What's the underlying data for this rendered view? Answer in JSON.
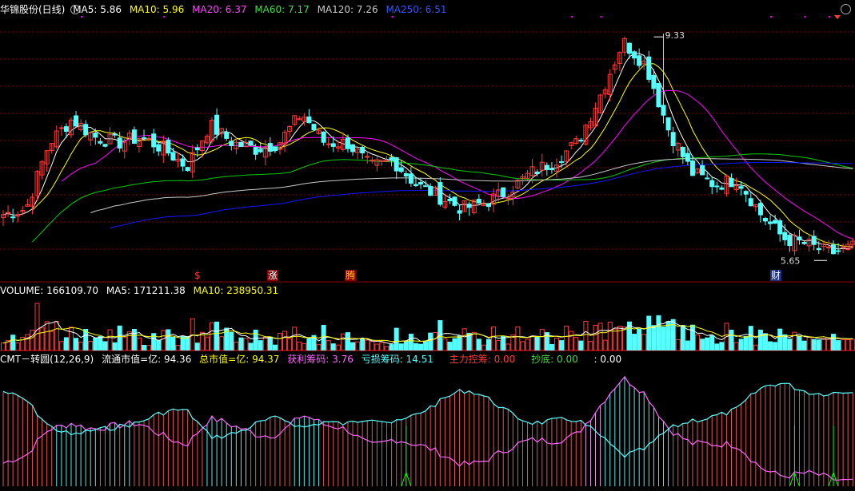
{
  "price_info": {
    "stock_name": "华锦股份(日线)",
    "ma5": "MA5: 5.86",
    "ma10": "MA10: 5.96",
    "ma20": "MA20: 6.37",
    "ma60": "MA60: 7.17",
    "ma120": "MA120: 7.26",
    "ma250": "MA250: 6.51"
  },
  "volume_info": {
    "volume": "VOLUME: 166109.70",
    "ma5": "MA5: 171211.38",
    "ma10": "MA10: 238950.31"
  },
  "cmt_info": {
    "name": "CMT－转圆(12,26,9)",
    "float_cap": "流通市值=亿: 94.36",
    "total_cap": "总市值=亿: 94.37",
    "profit_chips": "获利筹码: 3.76",
    "loss_chips": "亏损筹码: 14.51",
    "main_control": "主力控筹: 0.00",
    "bottom": "抄底: 0.00",
    "blank": ": 0.00"
  },
  "markers": {
    "m1": "$",
    "m2": "涨",
    "m3": "腾",
    "m4": "财"
  },
  "colors": {
    "background": "#000000",
    "up": "#ff3b3b",
    "down": "#54ffff",
    "ma5": "#ffffff",
    "ma10": "#ffff00",
    "ma20": "#ff00ff",
    "ma60": "#00cc00",
    "ma120": "#c8c8c8",
    "ma250": "#1414ff",
    "grid": "#8b0000"
  },
  "chart_data": [
    {
      "type": "candlestick",
      "title": "华锦股份(日线)",
      "high_label": "9.33",
      "low_label": "5.65",
      "y_range": [
        5.4,
        9.6
      ],
      "ma_last": {
        "MA5": 5.86,
        "MA10": 5.96,
        "MA20": 6.37,
        "MA60": 7.17,
        "MA120": 7.26,
        "MA250": 6.51
      },
      "close_waypoints": [
        6.3,
        6.4,
        7.5,
        7.9,
        7.6,
        7.5,
        7.6,
        7.4,
        7.1,
        7.8,
        7.5,
        7.4,
        7.5,
        8.0,
        7.5,
        7.5,
        7.1,
        7.2,
        6.8,
        6.6,
        6.4,
        6.5,
        6.7,
        7.0,
        7.2,
        7.5,
        8.3,
        9.2,
        8.8,
        7.7,
        7.0,
        6.8,
        6.9,
        6.3,
        5.9,
        5.8,
        5.65,
        5.75
      ]
    },
    {
      "type": "bar",
      "title": "VOLUME",
      "last_value": 166109.7,
      "ma5": 171211.38,
      "ma10": 238950.31
    },
    {
      "type": "line",
      "title": "CMT－转圆(12,26,9)"
    }
  ]
}
